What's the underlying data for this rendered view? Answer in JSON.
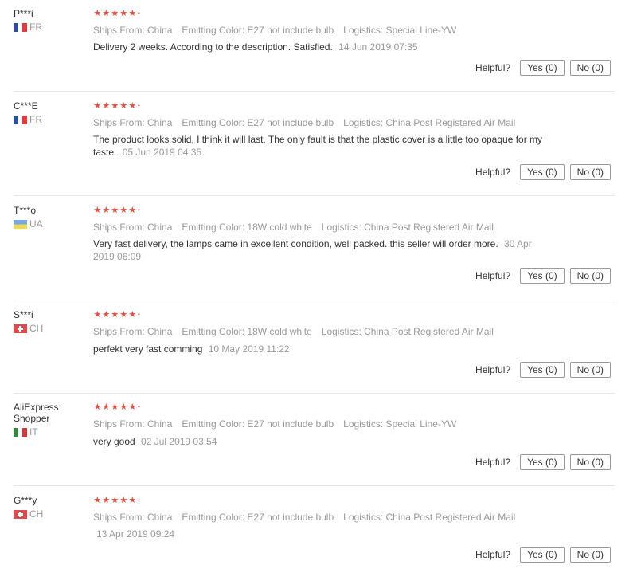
{
  "feedback": {
    "helpful_label": "Helpful?",
    "rating_dot": "•",
    "reviews": [
      {
        "user": "P***i",
        "country": "FR",
        "stars": 5,
        "ships_from": "Ships From: China",
        "emitting_color": "Emitting Color: E27 not include bulb",
        "logistics": "Logistics: Special Line-YW",
        "text": "Delivery 2 weeks. According to the description. Satisfied.",
        "date": "14 Jun 2019 07:35",
        "yes": "Yes (0)",
        "no": "No (0)"
      },
      {
        "user": "C***E",
        "country": "FR",
        "stars": 5,
        "ships_from": "Ships From: China",
        "emitting_color": "Emitting Color: E27 not include bulb",
        "logistics": "Logistics: China Post Registered Air Mail",
        "text": "The product looks solid, I think it will last. The only fault is that the plastic cover is a little too opaque for my taste.",
        "date": "05 Jun 2019 04:35",
        "yes": "Yes (0)",
        "no": "No (0)"
      },
      {
        "user": "T***o",
        "country": "UA",
        "stars": 5,
        "ships_from": "Ships From: China",
        "emitting_color": "Emitting Color: 18W cold white",
        "logistics": "Logistics: China Post Registered Air Mail",
        "text": "Very fast delivery, the lamps came in excellent condition, well packed. this seller will order more.",
        "date": "30 Apr 2019 06:09",
        "yes": "Yes (0)",
        "no": "No (0)"
      },
      {
        "user": "S***i",
        "country": "CH",
        "stars": 5,
        "ships_from": "Ships From: China",
        "emitting_color": "Emitting Color: 18W cold white",
        "logistics": "Logistics: China Post Registered Air Mail",
        "text": "perfekt very fast comming",
        "date": "10 May 2019 11:22",
        "yes": "Yes (0)",
        "no": "No (0)"
      },
      {
        "user": "AliExpress Shopper",
        "country": "IT",
        "stars": 5,
        "ships_from": "Ships From: China",
        "emitting_color": "Emitting Color: E27 not include bulb",
        "logistics": "Logistics: Special Line-YW",
        "text": "very good",
        "date": "02 Jul 2019 03:54",
        "yes": "Yes (0)",
        "no": "No (0)"
      },
      {
        "user": "G***y",
        "country": "CH",
        "stars": 5,
        "ships_from": "Ships From: China",
        "emitting_color": "Emitting Color: E27 not include bulb",
        "logistics": "Logistics: China Post Registered Air Mail",
        "text": "",
        "date": "13 Apr 2019 09:24",
        "yes": "Yes (0)",
        "no": "No (0)"
      }
    ]
  }
}
